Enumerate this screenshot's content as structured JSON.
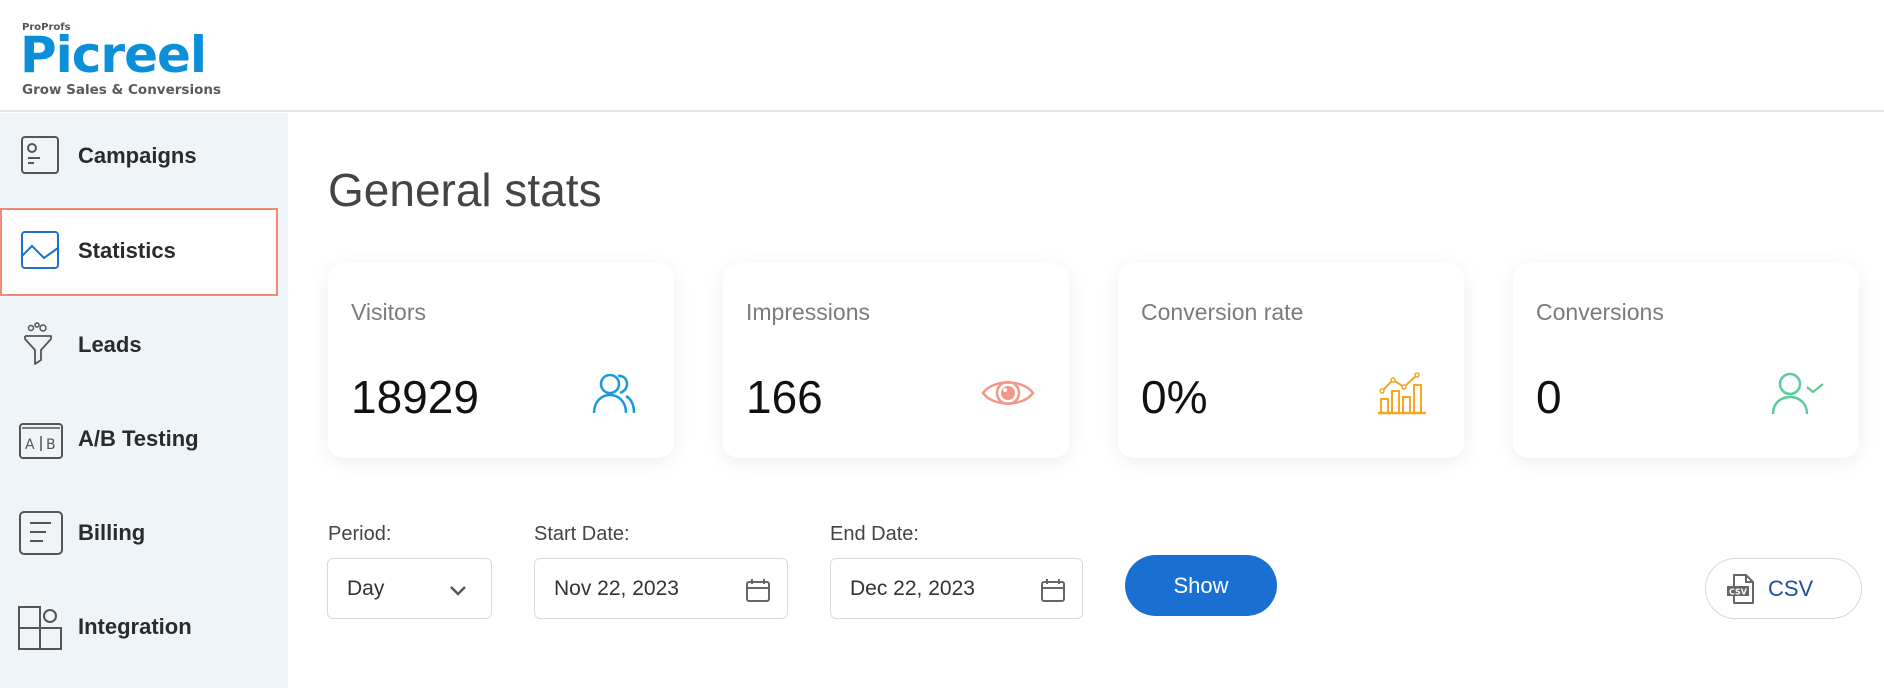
{
  "app": {
    "brand_prefix": "ProProfs",
    "brand_name": "Picreel",
    "tagline": "Grow Sales & Conversions",
    "brand_color": "#0b8fd9"
  },
  "sidebar": {
    "active": "Statistics",
    "items": [
      {
        "label": "Campaigns",
        "icon": "campaign-card-icon"
      },
      {
        "label": "Statistics",
        "icon": "chart-line-icon"
      },
      {
        "label": "Leads",
        "icon": "funnel-icon"
      },
      {
        "label": "A/B Testing",
        "icon": "ab-test-icon"
      },
      {
        "label": "Billing",
        "icon": "document-lines-icon"
      },
      {
        "label": "Integration",
        "icon": "blocks-icon"
      }
    ]
  },
  "main": {
    "title": "General stats",
    "cards": [
      {
        "label": "Visitors",
        "value": "18929",
        "icon": "users-icon",
        "color": "#1a9ad6"
      },
      {
        "label": "Impressions",
        "value": "166",
        "icon": "eye-icon",
        "color": "#f4978a"
      },
      {
        "label": "Conversion rate",
        "value": "0%",
        "icon": "growth-chart-icon",
        "color": "#f5a623"
      },
      {
        "label": "Conversions",
        "value": "0",
        "icon": "user-check-icon",
        "color": "#5ccb9a"
      }
    ],
    "filters": {
      "period_label": "Period:",
      "period_value": "Day",
      "start_label": "Start Date:",
      "start_value": "Nov 22, 2023",
      "end_label": "End Date:",
      "end_value": "Dec 22, 2023",
      "show_label": "Show",
      "csv_label": "CSV",
      "primary_color": "#1a6fd3"
    }
  }
}
